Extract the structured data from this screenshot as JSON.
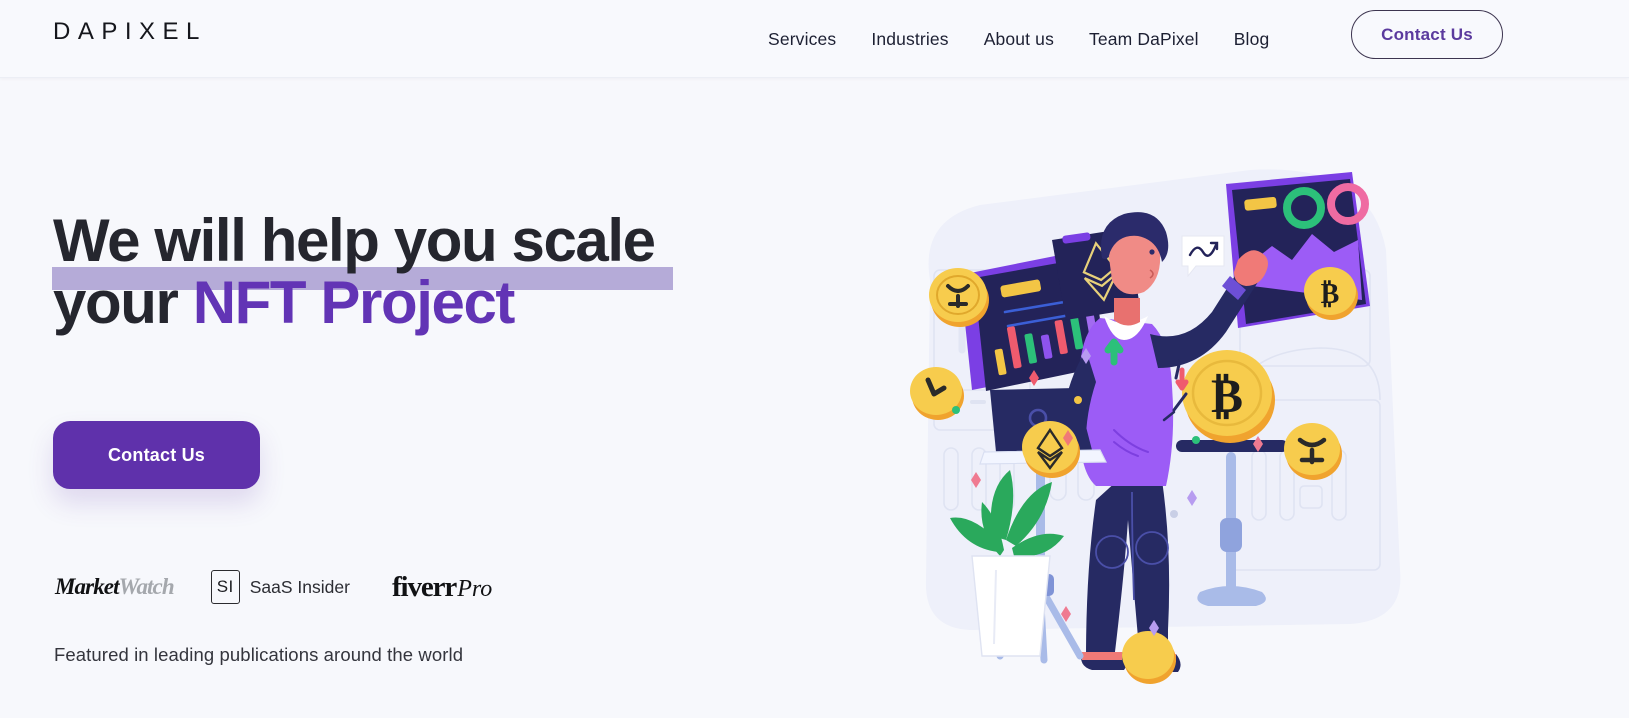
{
  "brand": {
    "logo_text": "DAPIXEL"
  },
  "header": {
    "nav": [
      {
        "label": "Services"
      },
      {
        "label": "Industries"
      },
      {
        "label": "About us"
      },
      {
        "label": "Team DaPixel"
      },
      {
        "label": "Blog"
      }
    ],
    "cta_label": "Contact Us"
  },
  "hero": {
    "headline_line1": "We will help you scale",
    "headline_line2_prefix": "your ",
    "headline_line2_accent": "NFT Project",
    "cta_label": "Contact Us",
    "featured_caption": "Featured in leading publications around the world",
    "brands": [
      {
        "name": "MarketWatch",
        "part_dark": "Market",
        "part_gray": "Watch"
      },
      {
        "name": "SaaS Insider",
        "mark": "SI",
        "label": "SaaS Insider"
      },
      {
        "name": "fiverr Pro",
        "word": "fiverr",
        "suffix": "Pro"
      }
    ]
  },
  "colors": {
    "page_background": "#f7f8fc",
    "header_background": "#f8f9fd",
    "primary_purple": "#5f31ab",
    "accent_purple": "#6234b5",
    "highlight_lavender": "#b5abd8",
    "text_dark": "#25262e",
    "nav_text": "#1d2033",
    "screen_navy": "#232359",
    "coin_gold": "#f5c343",
    "donut_green": "#2cc07a",
    "donut_pink": "#ef6ba2",
    "chart_purple": "#8e53ee"
  },
  "illustration": {
    "name": "nft-crypto-analytics-illustration",
    "elements": [
      "person-pointing-at-dashboard",
      "dashboard-screen",
      "candlestick-chart-card",
      "ethereum-card",
      "bitcoin-coin",
      "ripple-coin",
      "ethereum-coin",
      "laptop-on-stand",
      "potted-plant",
      "speech-bubble-trend"
    ]
  }
}
